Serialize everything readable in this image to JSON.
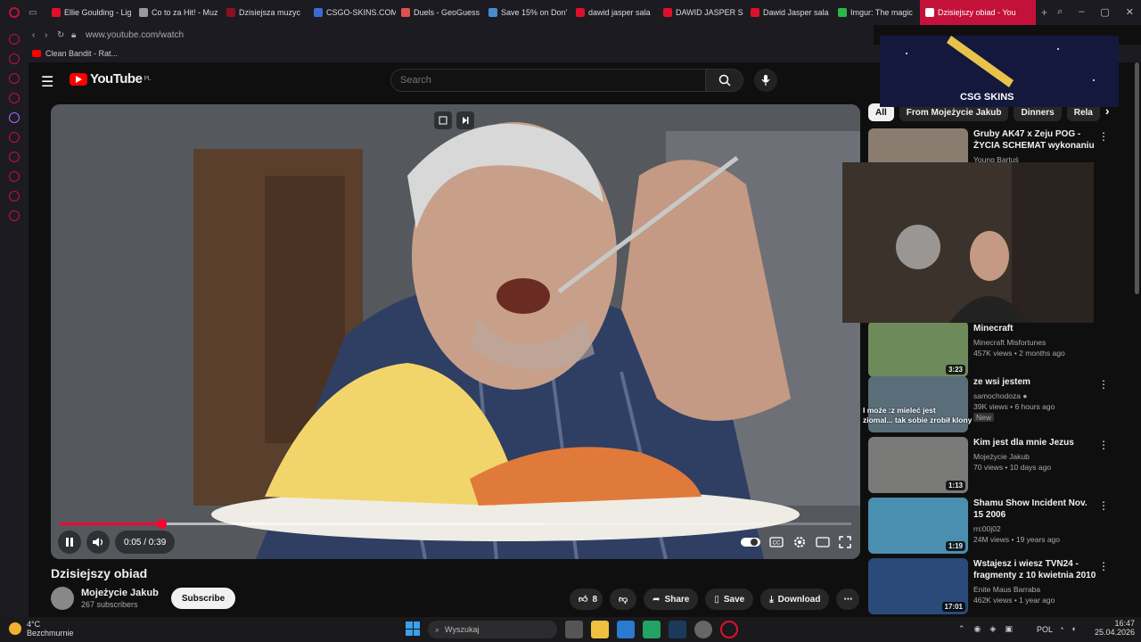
{
  "browser": {
    "tabs": [
      {
        "label": "Ellie Goulding - Lig",
        "color": "#e0102a"
      },
      {
        "label": "Co to za Hit! - Muz",
        "color": "#999999"
      },
      {
        "label": "Dzisiejsza muzyc",
        "color": "#8b1020"
      },
      {
        "label": "CSGO-SKINS.COM",
        "color": "#3b6ad1"
      },
      {
        "label": "Duels - GeoGuess",
        "color": "#e05050"
      },
      {
        "label": "Save 15% on Don'",
        "color": "#4a8ad1"
      },
      {
        "label": "dawid jasper sala",
        "color": "#e0102a"
      },
      {
        "label": "DAWID JASPER S",
        "color": "#e0102a"
      },
      {
        "label": "Dawid Jasper sala",
        "color": "#e0102a"
      },
      {
        "label": "Imgur: The magic",
        "color": "#2ab84a"
      }
    ],
    "active_tab": "Dzisiejszy obiad - You",
    "url": "www.youtube.com/watch",
    "bookmark": "Clean Bandit - Rat..."
  },
  "youtube": {
    "logo_text": "YouTube",
    "country": "PL",
    "search_placeholder": "Search"
  },
  "player": {
    "time_current": "0:05",
    "time_total": "0:39",
    "time_display": "0:05 / 0:39",
    "progress_fraction": 0.128,
    "buffered_fraction": 0.61
  },
  "video": {
    "title": "Dzisiejszy obiad",
    "channel": "Mojeżycie Jakub",
    "subscribers": "267 subscribers",
    "subscribe_label": "Subscribe",
    "likes": "8",
    "share_label": "Share",
    "save_label": "Save",
    "download_label": "Download"
  },
  "chips": [
    "All",
    "From Mojeżycie Jakub",
    "Dinners",
    "Rela"
  ],
  "recommendations": [
    {
      "title": "Gruby AK47 x Zeju POG - ŻYCIA SCHEMAT wykonaniu ...",
      "channel": "Young Bartuś",
      "meta": "",
      "duration": "",
      "thumb": "#8a7d70"
    },
    {
      "title": "Minecraft",
      "channel": "Minecraft Misfortunes",
      "meta": "457K views • 2 months ago",
      "duration": "3:23",
      "thumb": "#6d8a5a"
    },
    {
      "title": "ze wsi jestem",
      "channel": "samochodoza",
      "meta": "39K views • 6 hours ago",
      "duration": "",
      "badge": "New",
      "thumb": "#5a6e7a"
    },
    {
      "title": "Kim jest dla mnie Jezus",
      "channel": "Mojeżycie Jakub",
      "meta": "70 views • 10 days ago",
      "duration": "1:13",
      "thumb": "#7a7a78"
    },
    {
      "title": "Shamu Show Incident Nov. 15 2006",
      "channel": "rrc00j02",
      "meta": "24M views • 19 years ago",
      "duration": "1:19",
      "thumb": "#4a8fb0"
    },
    {
      "title": "Wstajesz i wiesz TVN24 - fragmenty z 10 kwietnia 2010 ...",
      "channel": "Enite Maus Barraba",
      "meta": "462K views • 1 year ago",
      "duration": "17:01",
      "thumb": "#2a4a7a"
    }
  ],
  "overlays": {
    "ad_text": "CSG SKINS",
    "chat_line1": "I może :z mieleć jest",
    "chat_line2": "ziomal... tak sobie zrobił klony"
  },
  "taskbar": {
    "weather_temp": "4°C",
    "weather_desc": "Bezchmurnie",
    "search_placeholder": "Wyszukaj",
    "language": "POL",
    "time": "16:47",
    "date": "25.04.2026"
  }
}
